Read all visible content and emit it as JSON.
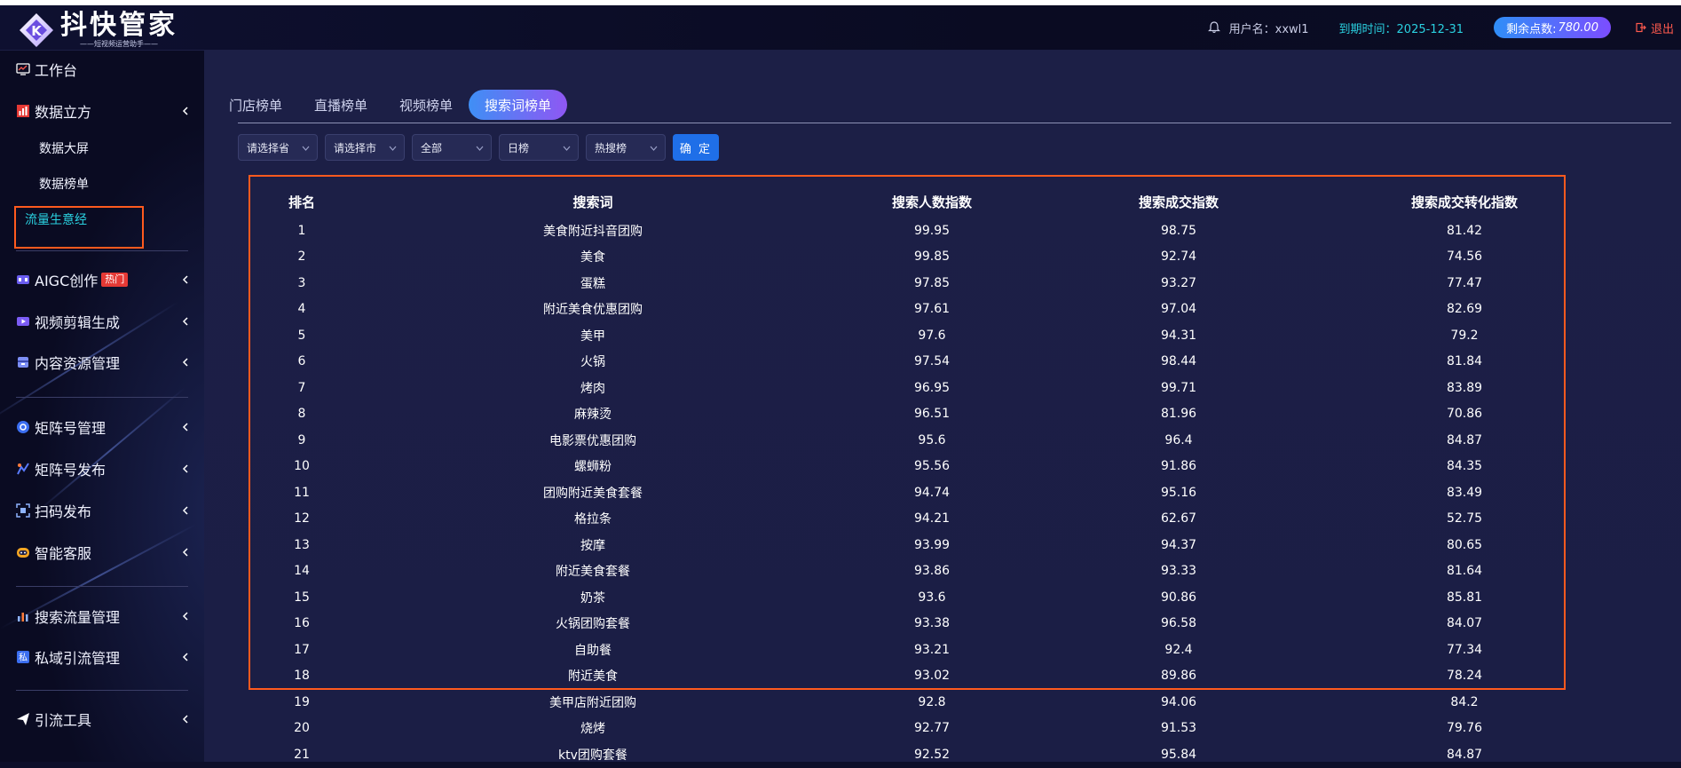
{
  "app": {
    "logo_title": "抖快管家",
    "logo_subtitle": "——短视频运营助手——"
  },
  "header": {
    "user_label": "用户名：xxwl1",
    "expire_label": "到期时间：2025-12-31",
    "points_label": "剩余点数:",
    "points_value": "780.00",
    "logout_label": "退出"
  },
  "sidebar": {
    "items": [
      {
        "label": "工作台",
        "icon": "monitor-icon"
      },
      {
        "label": "数据立方",
        "icon": "bar-chart-icon"
      },
      {
        "label": "AIGC创作",
        "icon": "ai-icon",
        "badge": "热门"
      },
      {
        "label": "视频剪辑生成",
        "icon": "video-icon"
      },
      {
        "label": "内容资源管理",
        "icon": "box-icon"
      },
      {
        "label": "矩阵号管理",
        "icon": "matrix-icon"
      },
      {
        "label": "矩阵号发布",
        "icon": "publish-icon"
      },
      {
        "label": "扫码发布",
        "icon": "scan-icon"
      },
      {
        "label": "智能客服",
        "icon": "robot-icon"
      },
      {
        "label": "搜索流量管理",
        "icon": "search-traffic-icon"
      },
      {
        "label": "私域引流管理",
        "icon": "private-traffic-icon"
      },
      {
        "label": "引流工具",
        "icon": "send-icon"
      }
    ],
    "sub_items": [
      {
        "label": "数据大屏"
      },
      {
        "label": "数据榜单"
      },
      {
        "label": "流量生意经"
      }
    ]
  },
  "tabs": [
    {
      "label": "门店榜单"
    },
    {
      "label": "直播榜单"
    },
    {
      "label": "视频榜单"
    },
    {
      "label": "搜索词榜单"
    }
  ],
  "filters": {
    "province": "请选择省",
    "city": "请选择市",
    "category": "全部",
    "period": "日榜",
    "rank_type": "热搜榜",
    "confirm_label": "确 定"
  },
  "table": {
    "headers": [
      "排名",
      "搜索词",
      "搜索人数指数",
      "搜索成交指数",
      "搜索成交转化指数"
    ],
    "rows": [
      [
        "1",
        "美食附近抖音团购",
        "99.95",
        "98.75",
        "81.42"
      ],
      [
        "2",
        "美食",
        "99.85",
        "92.74",
        "74.56"
      ],
      [
        "3",
        "蛋糕",
        "97.85",
        "93.27",
        "77.47"
      ],
      [
        "4",
        "附近美食优惠团购",
        "97.61",
        "97.04",
        "82.69"
      ],
      [
        "5",
        "美甲",
        "97.6",
        "94.31",
        "79.2"
      ],
      [
        "6",
        "火锅",
        "97.54",
        "98.44",
        "81.84"
      ],
      [
        "7",
        "烤肉",
        "96.95",
        "99.71",
        "83.89"
      ],
      [
        "8",
        "麻辣烫",
        "96.51",
        "81.96",
        "70.86"
      ],
      [
        "9",
        "电影票优惠团购",
        "95.6",
        "96.4",
        "84.87"
      ],
      [
        "10",
        "螺蛳粉",
        "95.56",
        "91.86",
        "84.35"
      ],
      [
        "11",
        "团购附近美食套餐",
        "94.74",
        "95.16",
        "83.49"
      ],
      [
        "12",
        "格拉条",
        "94.21",
        "62.67",
        "52.75"
      ],
      [
        "13",
        "按摩",
        "93.99",
        "94.37",
        "80.65"
      ],
      [
        "14",
        "附近美食套餐",
        "93.86",
        "93.33",
        "81.64"
      ],
      [
        "15",
        "奶茶",
        "93.6",
        "90.86",
        "85.81"
      ],
      [
        "16",
        "火锅团购套餐",
        "93.38",
        "96.58",
        "84.07"
      ],
      [
        "17",
        "自助餐",
        "93.21",
        "92.4",
        "77.34"
      ],
      [
        "18",
        "附近美食",
        "93.02",
        "89.86",
        "78.24"
      ],
      [
        "19",
        "美甲店附近团购",
        "92.8",
        "94.06",
        "84.2"
      ],
      [
        "20",
        "烧烤",
        "92.77",
        "91.53",
        "79.76"
      ],
      [
        "21",
        "ktv团购套餐",
        "92.52",
        "95.84",
        "84.87"
      ]
    ]
  },
  "colors": {
    "accent_cyan": "#2ad1e0",
    "highlight_orange": "#ff5a1e",
    "button_blue": "#1f6fe8",
    "hot_red": "#e53935"
  }
}
